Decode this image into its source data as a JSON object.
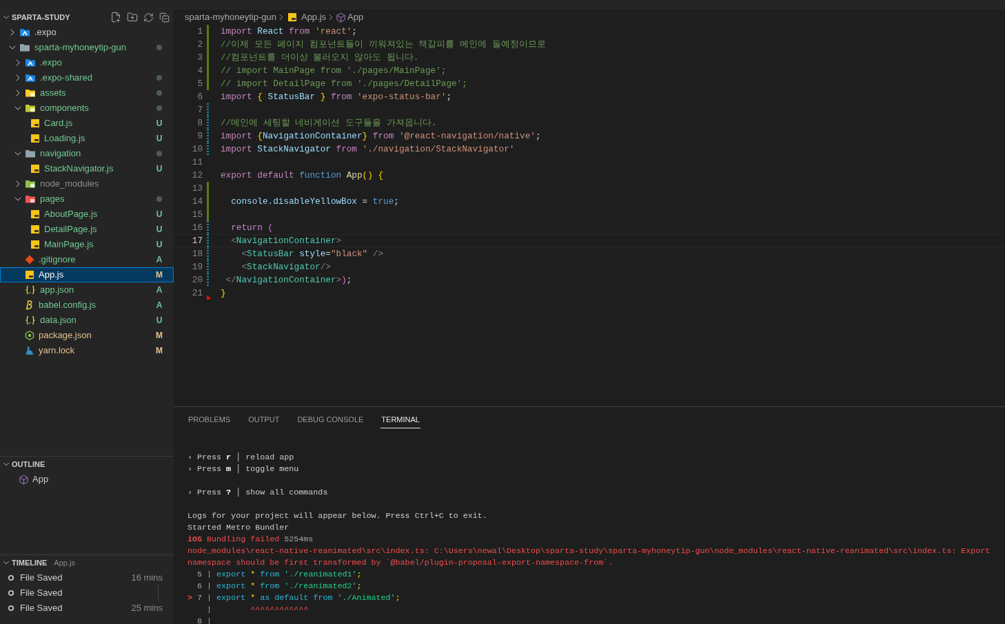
{
  "explorer": {
    "title": "SPARTA-STUDY",
    "tree": [
      {
        "name": ".expo",
        "kind": "expo-folder",
        "color": "#cccccc",
        "expanded": false,
        "changes": false,
        "selected": false
      },
      {
        "name": "sparta-myhoneytip-gun",
        "kind": "plain-folder",
        "color": "#73c991",
        "expanded": true,
        "changes": true,
        "selected": false,
        "children": [
          {
            "name": ".expo",
            "kind": "expo-folder",
            "color": "#73c991",
            "expanded": false,
            "changes": false,
            "selected": false
          },
          {
            "name": ".expo-shared",
            "kind": "expo-folder",
            "color": "#73c991",
            "expanded": false,
            "changes": true,
            "selected": false
          },
          {
            "name": "assets",
            "kind": "assets-folder",
            "color": "#73c991",
            "expanded": false,
            "changes": true,
            "selected": false
          },
          {
            "name": "components",
            "kind": "components-folder",
            "color": "#73c991",
            "expanded": true,
            "changes": true,
            "selected": false,
            "children": [
              {
                "name": "Card.js",
                "kind": "js",
                "color": "#73c991",
                "badge": "U",
                "selected": false
              },
              {
                "name": "Loading.js",
                "kind": "js",
                "color": "#73c991",
                "badge": "U",
                "selected": false
              }
            ]
          },
          {
            "name": "navigation",
            "kind": "plain-folder",
            "color": "#73c991",
            "expanded": true,
            "changes": true,
            "selected": false,
            "children": [
              {
                "name": "StackNavigator.js",
                "kind": "js",
                "color": "#73c991",
                "badge": "U",
                "selected": false
              }
            ]
          },
          {
            "name": "node_modules",
            "kind": "node-folder",
            "color": "#8c8c8c",
            "expanded": false,
            "changes": false,
            "selected": false
          },
          {
            "name": "pages",
            "kind": "pages-folder",
            "color": "#73c991",
            "expanded": true,
            "changes": true,
            "selected": false,
            "children": [
              {
                "name": "AboutPage.js",
                "kind": "js",
                "color": "#73c991",
                "badge": "U",
                "selected": false
              },
              {
                "name": "DetailPage.js",
                "kind": "js",
                "color": "#73c991",
                "badge": "U",
                "selected": false
              },
              {
                "name": "MainPage.js",
                "kind": "js",
                "color": "#73c991",
                "badge": "U",
                "selected": false
              }
            ]
          },
          {
            "name": ".gitignore",
            "kind": "git",
            "color": "#73c991",
            "badge": "A",
            "selected": false
          },
          {
            "name": "App.js",
            "kind": "js",
            "color": "#e2c08d",
            "badge": "M",
            "selected": true
          },
          {
            "name": "app.json",
            "kind": "json",
            "color": "#73c991",
            "badge": "A",
            "selected": false
          },
          {
            "name": "babel.config.js",
            "kind": "babel",
            "color": "#73c991",
            "badge": "A",
            "selected": false
          },
          {
            "name": "data.json",
            "kind": "json",
            "color": "#73c991",
            "badge": "U",
            "selected": false
          },
          {
            "name": "package.json",
            "kind": "node",
            "color": "#e2c08d",
            "badge": "M",
            "selected": false
          },
          {
            "name": "yarn.lock",
            "kind": "yarn",
            "color": "#e2c08d",
            "badge": "M",
            "selected": false
          }
        ]
      }
    ]
  },
  "outline": {
    "title": "OUTLINE",
    "items": [
      "App"
    ]
  },
  "timeline": {
    "title": "TIMELINE",
    "file": "App.js",
    "items": [
      {
        "label": "File Saved",
        "time": "16 mins"
      },
      {
        "label": "File Saved"
      },
      {
        "label": "File Saved",
        "time": "25 mins"
      }
    ]
  },
  "breadcrumb": [
    "sparta-myhoneytip-gun",
    "App.js",
    "App"
  ],
  "code": [
    {
      "n": "1",
      "kind": "added",
      "tokens": [
        {
          "kind": "kw",
          "text": "import "
        },
        {
          "kind": "id",
          "text": "React "
        },
        {
          "kind": "kw",
          "text": "from "
        },
        {
          "kind": "str",
          "text": "'react'"
        },
        {
          "kind": "p",
          "text": ";"
        }
      ]
    },
    {
      "n": "2",
      "kind": "added",
      "tokens": [
        {
          "kind": "cm",
          "text": "//이제 모든 페이지 컴포넌트들이 끼워져있는 책갈피를 메인에 둘예정이므로"
        }
      ]
    },
    {
      "n": "3",
      "kind": "added",
      "tokens": [
        {
          "kind": "cm",
          "text": "//컴포넌트를 더이상 불러오지 않아도 됩니다."
        }
      ]
    },
    {
      "n": "4",
      "kind": "added",
      "tokens": [
        {
          "kind": "cm",
          "text": "// import MainPage from './pages/MainPage';"
        }
      ]
    },
    {
      "n": "5",
      "kind": "added",
      "tokens": [
        {
          "kind": "cm",
          "text": "// import DetailPage from './pages/DetailPage';"
        }
      ]
    },
    {
      "n": "6",
      "kind": "plain",
      "tokens": [
        {
          "kind": "kw",
          "text": "import "
        },
        {
          "kind": "br1",
          "text": "{ "
        },
        {
          "kind": "id",
          "text": "StatusBar "
        },
        {
          "kind": "br1",
          "text": "} "
        },
        {
          "kind": "kw",
          "text": "from "
        },
        {
          "kind": "str",
          "text": "'expo-status-bar'"
        },
        {
          "kind": "p",
          "text": ";"
        }
      ]
    },
    {
      "n": "7",
      "kind": "modified"
    },
    {
      "n": "8",
      "kind": "modified",
      "tokens": [
        {
          "kind": "cm",
          "text": "//메인에 세팅할 네비게이션 도구들을 가져옵니다."
        }
      ]
    },
    {
      "n": "9",
      "kind": "modified",
      "tokens": [
        {
          "kind": "kw",
          "text": "import "
        },
        {
          "kind": "br1",
          "text": "{"
        },
        {
          "kind": "id",
          "text": "NavigationContainer"
        },
        {
          "kind": "br1",
          "text": "} "
        },
        {
          "kind": "kw",
          "text": "from "
        },
        {
          "kind": "str",
          "text": "'@react-navigation/native'"
        },
        {
          "kind": "p",
          "text": ";"
        }
      ]
    },
    {
      "n": "10",
      "kind": "modified",
      "tokens": [
        {
          "kind": "kw",
          "text": "import "
        },
        {
          "kind": "id",
          "text": "StackNavigator "
        },
        {
          "kind": "kw",
          "text": "from "
        },
        {
          "kind": "str",
          "text": "'./navigation/StackNavigator'"
        }
      ]
    },
    {
      "n": "11",
      "kind": "plain"
    },
    {
      "n": "12",
      "kind": "plain",
      "tokens": [
        {
          "kind": "kw",
          "text": "export default "
        },
        {
          "kind": "st",
          "text": "function "
        },
        {
          "kind": "fn",
          "text": "App"
        },
        {
          "kind": "br1",
          "text": "() {"
        }
      ]
    },
    {
      "n": "13",
      "kind": "added"
    },
    {
      "n": "14",
      "kind": "added",
      "tokens": [
        {
          "kind": "id",
          "text": "  console.disableYellowBox "
        },
        {
          "kind": "p",
          "text": "= "
        },
        {
          "kind": "st",
          "text": "true"
        },
        {
          "kind": "p",
          "text": ";"
        }
      ]
    },
    {
      "n": "15",
      "kind": "added"
    },
    {
      "n": "16",
      "kind": "modified",
      "tokens": [
        {
          "kind": "kw",
          "text": "  return "
        },
        {
          "kind": "br2",
          "text": "("
        }
      ]
    },
    {
      "n": "17",
      "kind": "modified",
      "current": true,
      "tokens": [
        {
          "kind": "ang",
          "text": "  <"
        },
        {
          "kind": "tag",
          "text": "NavigationContainer"
        },
        {
          "kind": "ang",
          "text": ">"
        }
      ]
    },
    {
      "n": "18",
      "kind": "modified",
      "tokens": [
        {
          "kind": "ang",
          "text": "    <"
        },
        {
          "kind": "tag",
          "text": "StatusBar "
        },
        {
          "kind": "id",
          "text": "style"
        },
        {
          "kind": "p",
          "text": "="
        },
        {
          "kind": "str",
          "text": "\"black\" "
        },
        {
          "kind": "ang",
          "text": "/>"
        }
      ]
    },
    {
      "n": "19",
      "kind": "modified",
      "tokens": [
        {
          "kind": "ang",
          "text": "    <"
        },
        {
          "kind": "tag",
          "text": "StackNavigator"
        },
        {
          "kind": "ang",
          "text": "/>"
        }
      ]
    },
    {
      "n": "20",
      "kind": "modified",
      "tokens": [
        {
          "kind": "ang",
          "text": " </"
        },
        {
          "kind": "tag",
          "text": "NavigationContainer"
        },
        {
          "kind": "ang",
          "text": ">"
        },
        {
          "kind": "br2",
          "text": ")"
        },
        {
          "kind": "p",
          "text": ";"
        }
      ]
    },
    {
      "n": "21",
      "kind": "deleted",
      "tokens": [
        {
          "kind": "br1",
          "text": "}"
        }
      ]
    }
  ],
  "panel": {
    "tabs": [
      {
        "label": "PROBLEMS",
        "selected": false
      },
      {
        "label": "OUTPUT",
        "selected": false
      },
      {
        "label": "DEBUG CONSOLE",
        "selected": false
      },
      {
        "label": "TERMINAL",
        "selected": true
      }
    ],
    "terminal": [
      {
        "kind": "text",
        "tokens": [
          {
            "kind": "t",
            "text": "› Press "
          },
          {
            "kind": "b",
            "text": "r"
          },
          {
            "kind": "t",
            "text": " │ reload app"
          }
        ]
      },
      {
        "kind": "text",
        "tokens": [
          {
            "kind": "t",
            "text": "› Press "
          },
          {
            "kind": "b",
            "text": "m"
          },
          {
            "kind": "t",
            "text": " │ toggle menu"
          }
        ]
      },
      {
        "kind": "blank"
      },
      {
        "kind": "text",
        "tokens": [
          {
            "kind": "t",
            "text": "› Press "
          },
          {
            "kind": "b",
            "text": "?"
          },
          {
            "kind": "t",
            "text": " │ show all commands"
          }
        ]
      },
      {
        "kind": "blank"
      },
      {
        "kind": "text",
        "tokens": [
          {
            "kind": "t",
            "text": "Logs for your project will appear below. Press Ctrl+C to exit."
          }
        ]
      },
      {
        "kind": "text",
        "tokens": [
          {
            "kind": "t",
            "text": "Started Metro Bundler"
          }
        ]
      },
      {
        "kind": "text",
        "tokens": [
          {
            "kind": "errb",
            "text": "iOS "
          },
          {
            "kind": "err",
            "text": "Bundling failed "
          },
          {
            "kind": "dim",
            "text": "5254ms"
          }
        ]
      },
      {
        "kind": "text",
        "tokens": [
          {
            "kind": "err",
            "text": "node_modules\\react-native-reanimated\\src\\index.ts: C:\\Users\\newal\\Desktop\\sparta-study\\sparta-myhoneytip-gun\\node_modules\\react-native-reanimated\\src\\index.ts: Export"
          }
        ]
      },
      {
        "kind": "text",
        "tokens": [
          {
            "kind": "err",
            "text": "namespace should be first transformed by `@babel/plugin-proposal-export-namespace-from`."
          }
        ]
      },
      {
        "kind": "text",
        "tokens": [
          {
            "kind": "dim",
            "text": "  5 | "
          },
          {
            "kind": "cy",
            "text": "export "
          },
          {
            "kind": "ye",
            "text": "* "
          },
          {
            "kind": "cy",
            "text": "from "
          },
          {
            "kind": "gr",
            "text": "'./reanimated1'"
          },
          {
            "kind": "ye",
            "text": ";"
          }
        ]
      },
      {
        "kind": "text",
        "tokens": [
          {
            "kind": "dim",
            "text": "  6 | "
          },
          {
            "kind": "cy",
            "text": "export "
          },
          {
            "kind": "ye",
            "text": "* "
          },
          {
            "kind": "cy",
            "text": "from "
          },
          {
            "kind": "gr",
            "text": "'./reanimated2'"
          },
          {
            "kind": "ye",
            "text": ";"
          }
        ]
      },
      {
        "kind": "text",
        "tokens": [
          {
            "kind": "errb",
            "text": "> "
          },
          {
            "kind": "dim",
            "text": "7 | "
          },
          {
            "kind": "cy",
            "text": "export "
          },
          {
            "kind": "ye",
            "text": "* "
          },
          {
            "kind": "cy",
            "text": "as default from "
          },
          {
            "kind": "gr",
            "text": "'./Animated'"
          },
          {
            "kind": "ye",
            "text": ";"
          }
        ]
      },
      {
        "kind": "text",
        "tokens": [
          {
            "kind": "dim",
            "text": "    | "
          },
          {
            "kind": "err",
            "text": "       ^^^^^^^^^^^^"
          }
        ]
      },
      {
        "kind": "text",
        "tokens": [
          {
            "kind": "dim",
            "text": "  8 |"
          }
        ]
      }
    ]
  }
}
